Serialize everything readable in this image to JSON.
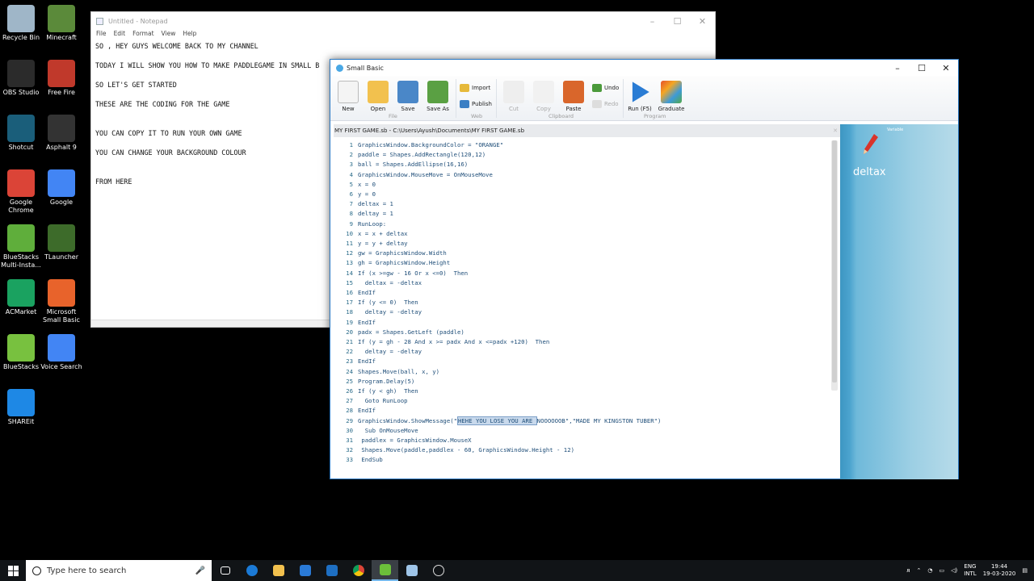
{
  "desktop": {
    "icons": [
      {
        "label": "Recycle Bin",
        "icon": "recycle-bin-icon",
        "color": "#9fb6c8"
      },
      {
        "label": "Minecraft",
        "icon": "minecraft-icon",
        "color": "#5b8a3a"
      },
      {
        "label": "OBS Studio",
        "icon": "obs-icon",
        "color": "#2b2b2b"
      },
      {
        "label": "Free Fire",
        "icon": "free-fire-icon",
        "color": "#c0392b"
      },
      {
        "label": "Shotcut",
        "icon": "shotcut-icon",
        "color": "#1a5e7a"
      },
      {
        "label": "Asphalt 9",
        "icon": "asphalt-icon",
        "color": "#333"
      },
      {
        "label": "Google Chrome",
        "icon": "chrome-icon",
        "color": "#db4437"
      },
      {
        "label": "Google",
        "icon": "google-icon",
        "color": "#4285f4"
      },
      {
        "label": "BlueStacks Multi-Insta...",
        "icon": "bluestacks-icon",
        "color": "#5fae3b"
      },
      {
        "label": "TLauncher",
        "icon": "tlauncher-icon",
        "color": "#3d6b2a"
      },
      {
        "label": "ACMarket",
        "icon": "acmarket-icon",
        "color": "#1aa260"
      },
      {
        "label": "Microsoft Small Basic",
        "icon": "small-basic-icon",
        "color": "#e8632b"
      },
      {
        "label": "BlueStacks",
        "icon": "bluestacks-icon",
        "color": "#78c13f"
      },
      {
        "label": "Voice Search",
        "icon": "voice-search-icon",
        "color": "#4285f4"
      },
      {
        "label": "SHAREit",
        "icon": "shareit-icon",
        "color": "#1e88e5"
      }
    ]
  },
  "notepad": {
    "title": "Untitled - Notepad",
    "menu": [
      "File",
      "Edit",
      "Format",
      "View",
      "Help"
    ],
    "lines": [
      "SO , HEY GUYS WELCOME BACK TO MY CHANNEL",
      "",
      "TODAY I WILL SHOW YOU HOW TO MAKE PADDLEGAME IN SMALL B",
      "",
      "SO LET'S GET STARTED",
      "",
      "THESE ARE THE CODING FOR THE GAME",
      "",
      "",
      "YOU CAN COPY IT TO RUN YOUR OWN GAME",
      "",
      "YOU CAN CHANGE YOUR BACKGROUND COLOUR",
      "",
      "",
      "FROM HERE"
    ]
  },
  "smallbasic": {
    "title": "Small Basic",
    "ribbon": {
      "new": "New",
      "open": "Open",
      "save": "Save",
      "save_as": "Save As",
      "import": "Import",
      "publish": "Publish",
      "cut": "Cut",
      "copy": "Copy",
      "paste": "Paste",
      "undo": "Undo",
      "redo": "Redo",
      "run": "Run (F5)",
      "graduate": "Graduate",
      "group_file": "File",
      "group_web": "Web",
      "group_clipboard": "Clipboard",
      "group_program": "Program"
    },
    "document": "MY FIRST GAME.sb - C:\\Users\\Ayush\\Documents\\MY FIRST GAME.sb",
    "code": [
      "GraphicsWindow.BackgroundColor = \"ORANGE\"",
      "paddle = Shapes.AddRectangle(120,12)",
      "ball = Shapes.AddEllipse(16,16)",
      "GraphicsWindow.MouseMove = OnMouseMove",
      "x = 0",
      "y = 0",
      "deltax = 1",
      "deltay = 1",
      "RunLoop:",
      "x = x + deltax",
      "y = y + deltay",
      "gw = GraphicsWindow.Width",
      "gh = GraphicsWindow.Height",
      "If (x >=gw - 16 Or x <=0)  Then",
      "  deltax = -deltax",
      "EndIf",
      "If (y <= 0)  Then",
      "  deltay = -deltay",
      "EndIf",
      "padx = Shapes.GetLeft (paddle)",
      "If (y = gh - 28 And x >= padx And x <=padx +120)  Then",
      "  deltay = -deltay",
      "EndIf",
      "Shapes.Move(ball, x, y)",
      "Program.Delay(5)",
      "If (y < gh)  Then",
      "  Goto RunLoop",
      "EndIf",
      "GraphicsWindow.ShowMessage(\"HEHE YOU LOSE YOU ARE NOOOOOOB\",\"MADE MY KINGSTON TUBER\")",
      "  Sub OnMouseMove",
      " paddlex = GraphicsWindow.MouseX",
      " Shapes.Move(paddle,paddlex - 60, GraphicsWindow.Height - 12)",
      " EndSub"
    ],
    "selected_text": "HEHE YOU LOSE YOU ARE ",
    "variable_panel": {
      "small": "Variable",
      "name": "deltax"
    }
  },
  "taskbar": {
    "search_placeholder": "Type here to search",
    "tray_lang": "ENG",
    "tray_region": "INTL",
    "time": "19:44",
    "date": "19-03-2020"
  }
}
